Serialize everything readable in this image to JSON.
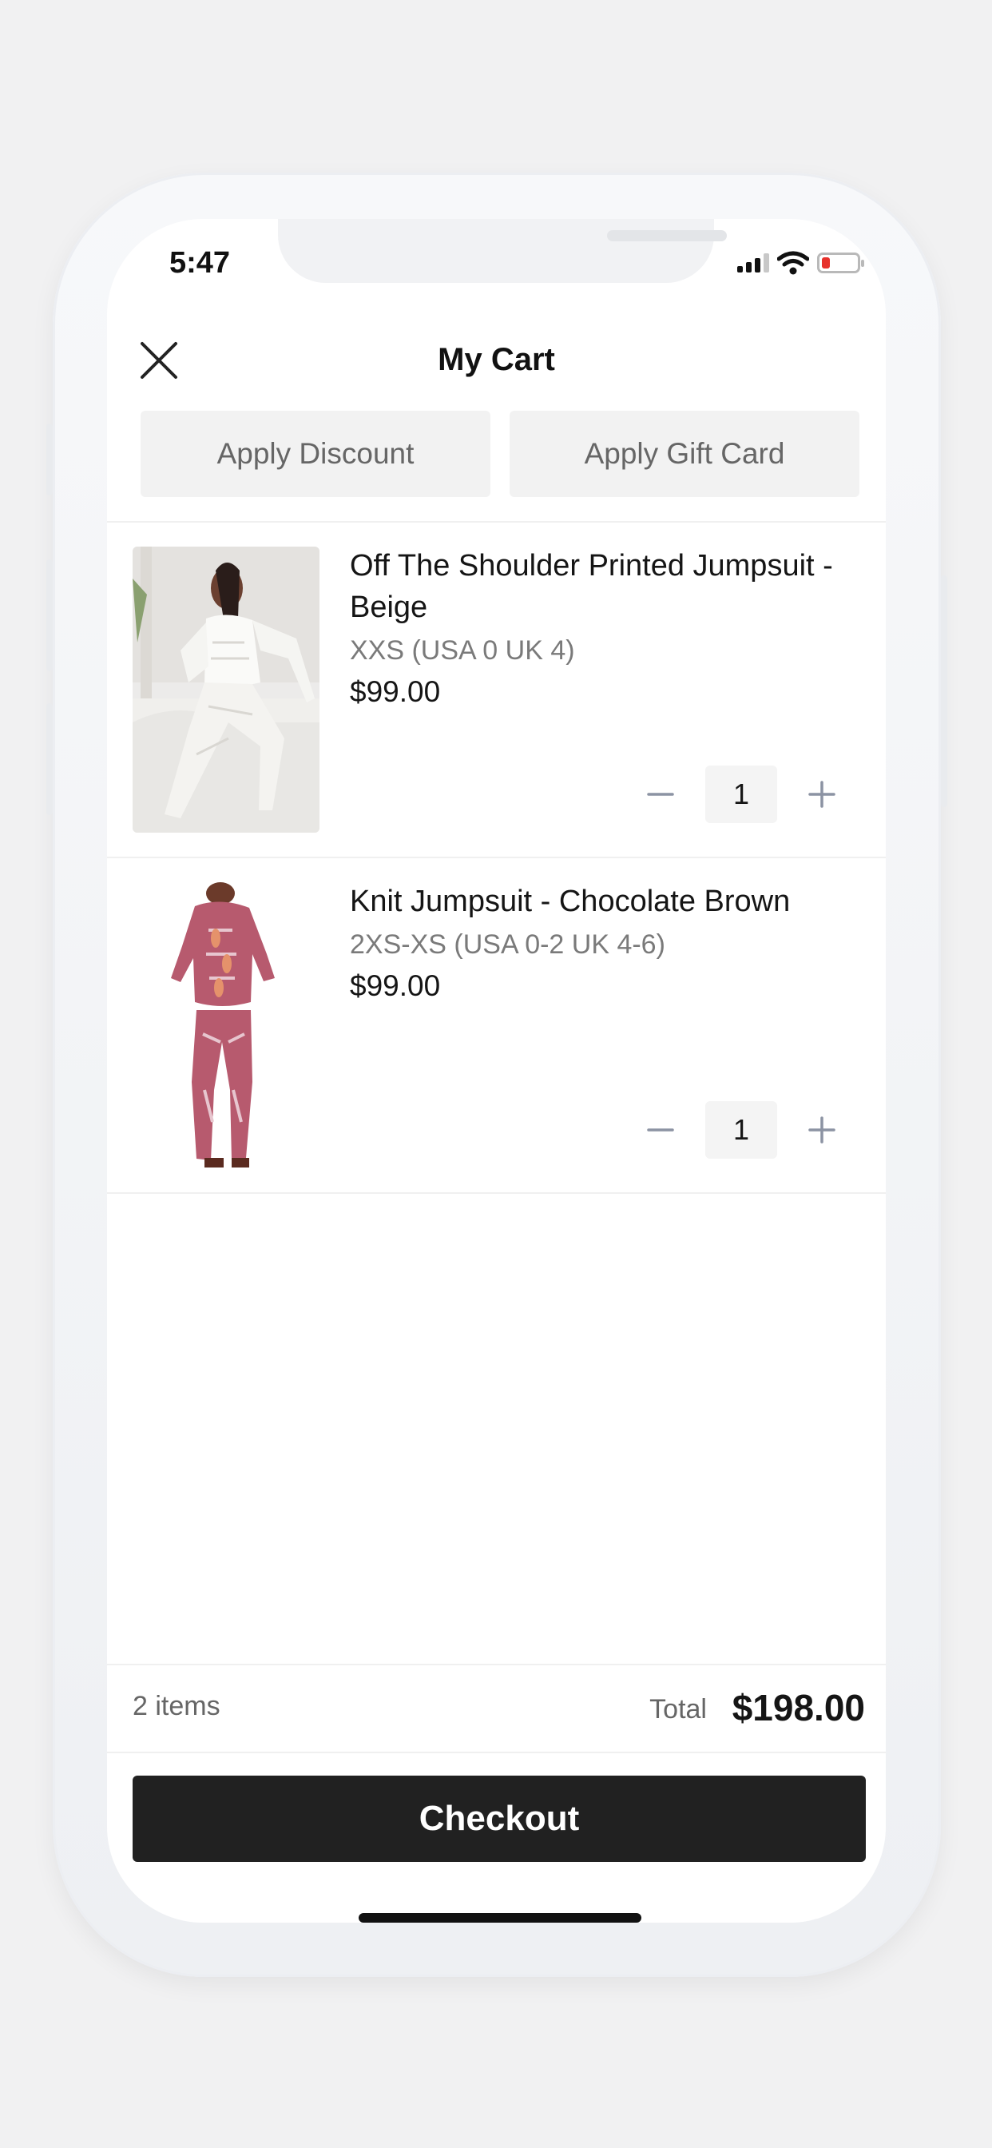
{
  "status": {
    "time": "5:47",
    "battery_color": "#e7312b"
  },
  "header": {
    "title": "My Cart",
    "close_icon": "close-x-icon"
  },
  "actions": {
    "discount_label": "Apply Discount",
    "gift_card_label": "Apply Gift Card"
  },
  "items": [
    {
      "name": "Off The Shoulder Printed Jumpsuit - Beige",
      "size": "XXS (USA 0 UK 4)",
      "price": "$99.00",
      "quantity": "1"
    },
    {
      "name": "Knit Jumpsuit - Chocolate Brown",
      "size": "2XS-XS (USA 0-2 UK 4-6)",
      "price": "$99.00",
      "quantity": "1"
    }
  ],
  "summary": {
    "count": "2 items",
    "total_label": "Total",
    "total_value": "$198.00"
  },
  "checkout": {
    "label": "Checkout",
    "color": "#212121"
  }
}
